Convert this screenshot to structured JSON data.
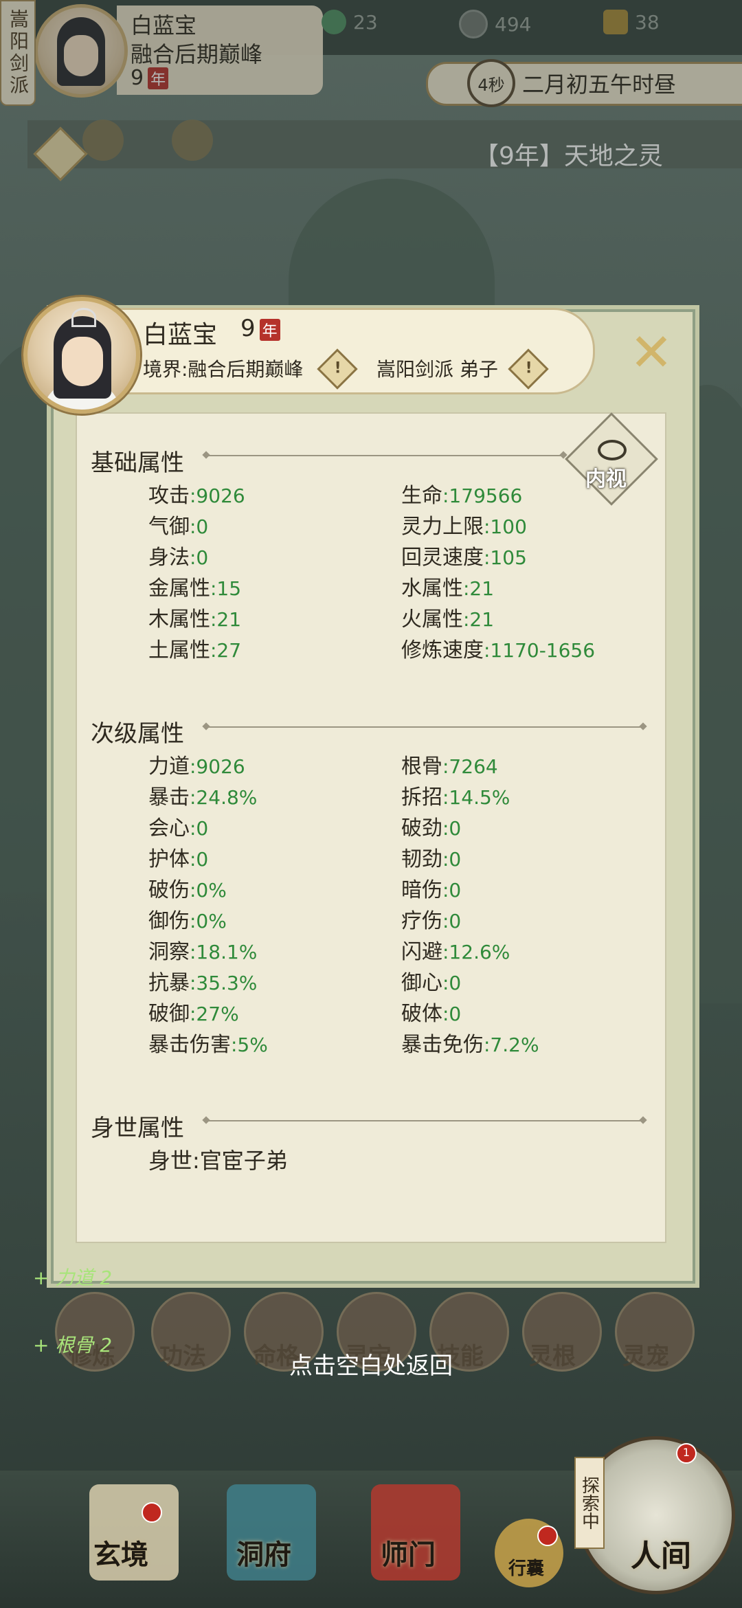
{
  "header": {
    "sect_tag": "嵩阳剑派",
    "name": "白蓝宝",
    "realm": "融合后期巅峰",
    "age": "9",
    "age_unit": "年",
    "resources": [
      {
        "icon": "spirit-stone-icon",
        "value": "23"
      },
      {
        "icon": "coin-icon",
        "value": "494"
      },
      {
        "icon": "strength-icon",
        "value": "38"
      }
    ],
    "timer": "4秒",
    "date": "二月初五午时昼",
    "news": "【9年】天地之灵"
  },
  "dialog": {
    "name": "白蓝宝",
    "age": "9",
    "age_unit": "年",
    "realm": "境界:融合后期巅峰",
    "sect": "嵩阳剑派 弟子",
    "inspect_label": "内视",
    "sections": {
      "basic": {
        "title": "基础属性",
        "left": [
          {
            "label": "攻击",
            "value": ":9026"
          },
          {
            "label": "气御",
            "value": ":0"
          },
          {
            "label": "身法",
            "value": ":0"
          },
          {
            "label": "金属性",
            "value": ":15"
          },
          {
            "label": "木属性",
            "value": ":21"
          },
          {
            "label": "土属性",
            "value": ":27"
          }
        ],
        "right": [
          {
            "label": "生命",
            "value": ":179566"
          },
          {
            "label": "灵力上限",
            "value": ":100"
          },
          {
            "label": "回灵速度",
            "value": ":105"
          },
          {
            "label": "水属性",
            "value": ":21"
          },
          {
            "label": "火属性",
            "value": ":21"
          },
          {
            "label": "修炼速度",
            "value": ":1170-1656"
          }
        ]
      },
      "secondary": {
        "title": "次级属性",
        "left": [
          {
            "label": "力道",
            "value": ":9026"
          },
          {
            "label": "暴击",
            "value": ":24.8%"
          },
          {
            "label": "会心",
            "value": ":0"
          },
          {
            "label": "护体",
            "value": ":0"
          },
          {
            "label": "破伤",
            "value": ":0%"
          },
          {
            "label": "御伤",
            "value": ":0%"
          },
          {
            "label": "洞察",
            "value": ":18.1%"
          },
          {
            "label": "抗暴",
            "value": ":35.3%"
          },
          {
            "label": "破御",
            "value": ":27%"
          },
          {
            "label": "暴击伤害",
            "value": ":5%"
          }
        ],
        "right": [
          {
            "label": "根骨",
            "value": ":7264"
          },
          {
            "label": "拆招",
            "value": ":14.5%"
          },
          {
            "label": "破劲",
            "value": ":0"
          },
          {
            "label": "韧劲",
            "value": ":0"
          },
          {
            "label": "暗伤",
            "value": ":0"
          },
          {
            "label": "疗伤",
            "value": ":0"
          },
          {
            "label": "闪避",
            "value": ":12.6%"
          },
          {
            "label": "御心",
            "value": ":0"
          },
          {
            "label": "破体",
            "value": ":0"
          },
          {
            "label": "暴击免伤",
            "value": ":7.2%"
          }
        ]
      },
      "background": {
        "title": "身世属性",
        "label": "身世",
        "value": ":官宦子弟"
      }
    }
  },
  "bonuses": [
    "+ 力道 2",
    "+ 根骨 2"
  ],
  "hint": "点击空白处返回",
  "menu": [
    "修炼",
    "功法",
    "命格",
    "灵宝",
    "技能",
    "灵根",
    "灵宠"
  ],
  "bottom_nav": [
    "玄境",
    "洞府",
    "师门",
    "行囊",
    "人间"
  ],
  "explore": {
    "label": "探索中",
    "badge": "1"
  },
  "colors": {
    "value_green": "#2f8a3a",
    "panel": "#efebd8",
    "badge_red": "#b5322b"
  }
}
